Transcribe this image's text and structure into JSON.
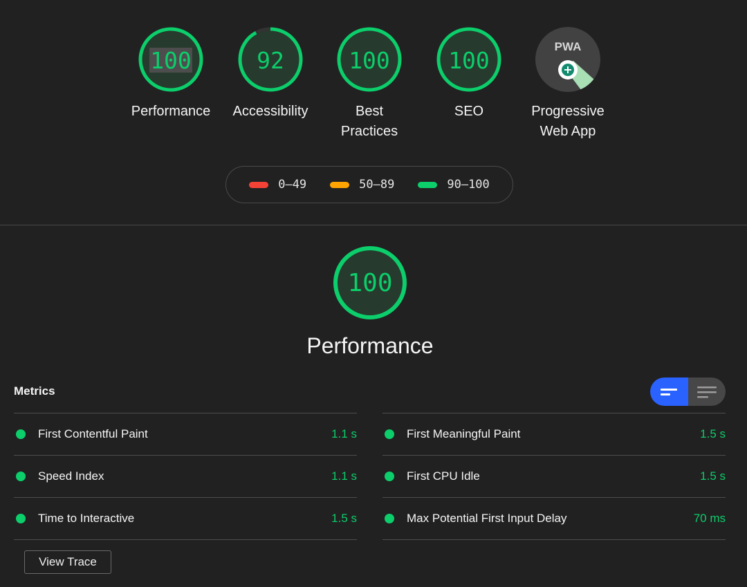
{
  "categories": [
    {
      "label": "Performance",
      "score": "100",
      "value": 100
    },
    {
      "label": "Accessibility",
      "score": "92",
      "value": 92
    },
    {
      "label": "Best Practices",
      "score": "100",
      "value": 100
    },
    {
      "label": "SEO",
      "score": "100",
      "value": 100
    },
    {
      "label": "Progressive Web App",
      "badge": "PWA"
    }
  ],
  "legend": [
    {
      "label": "0–49",
      "color": "#f44336"
    },
    {
      "label": "50–89",
      "color": "#ffa400"
    },
    {
      "label": "90–100",
      "color": "#0cce6b"
    }
  ],
  "colors": {
    "pass": "#0cce6b",
    "accent": "#2962ff"
  },
  "main": {
    "score": "100",
    "value": 100,
    "title": "Performance"
  },
  "metrics": {
    "title": "Metrics",
    "left": [
      {
        "label": "First Contentful Paint",
        "value": "1.1 s"
      },
      {
        "label": "Speed Index",
        "value": "1.1 s"
      },
      {
        "label": "Time to Interactive",
        "value": "1.5 s"
      }
    ],
    "right": [
      {
        "label": "First Meaningful Paint",
        "value": "1.5 s"
      },
      {
        "label": "First CPU Idle",
        "value": "1.5 s"
      },
      {
        "label": "Max Potential First Input Delay",
        "value": "70 ms"
      }
    ],
    "view_trace_label": "View Trace"
  }
}
